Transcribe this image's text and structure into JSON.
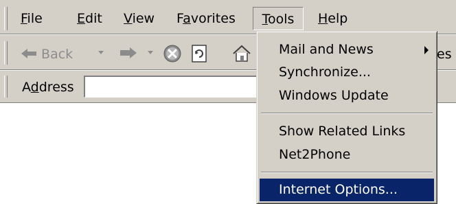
{
  "menubar": {
    "items": [
      {
        "pre": "",
        "mn": "F",
        "post": "ile"
      },
      {
        "pre": "",
        "mn": "E",
        "post": "dit"
      },
      {
        "pre": "",
        "mn": "V",
        "post": "iew"
      },
      {
        "pre": "F",
        "mn": "a",
        "post": "vorites"
      },
      {
        "pre": "",
        "mn": "T",
        "post": "ools"
      },
      {
        "pre": "",
        "mn": "H",
        "post": "elp"
      }
    ],
    "active_index": 4
  },
  "toolbar": {
    "back_label": "Back",
    "overflow_text": "es",
    "icons": [
      "back-arrow-icon",
      "dropdown-arrow-icon",
      "forward-arrow-icon",
      "stop-icon",
      "refresh-icon",
      "home-icon"
    ]
  },
  "addressbar": {
    "label_pre": "A",
    "label_mn": "d",
    "label_post": "dress",
    "value": ""
  },
  "tools_menu": {
    "items": [
      {
        "label": "Mail and News",
        "submenu": true
      },
      {
        "label": "Synchronize...",
        "submenu": false
      },
      {
        "label": "Windows Update",
        "submenu": false
      },
      {
        "label": "Show Related Links",
        "submenu": false
      },
      {
        "label": "Net2Phone",
        "submenu": false
      },
      {
        "label": "Internet Options...",
        "submenu": false,
        "highlighted": true
      }
    ]
  },
  "colors": {
    "chrome": "#d4d0c8",
    "highlight": "#0a246a",
    "disabled_text": "#8c8c8c"
  }
}
